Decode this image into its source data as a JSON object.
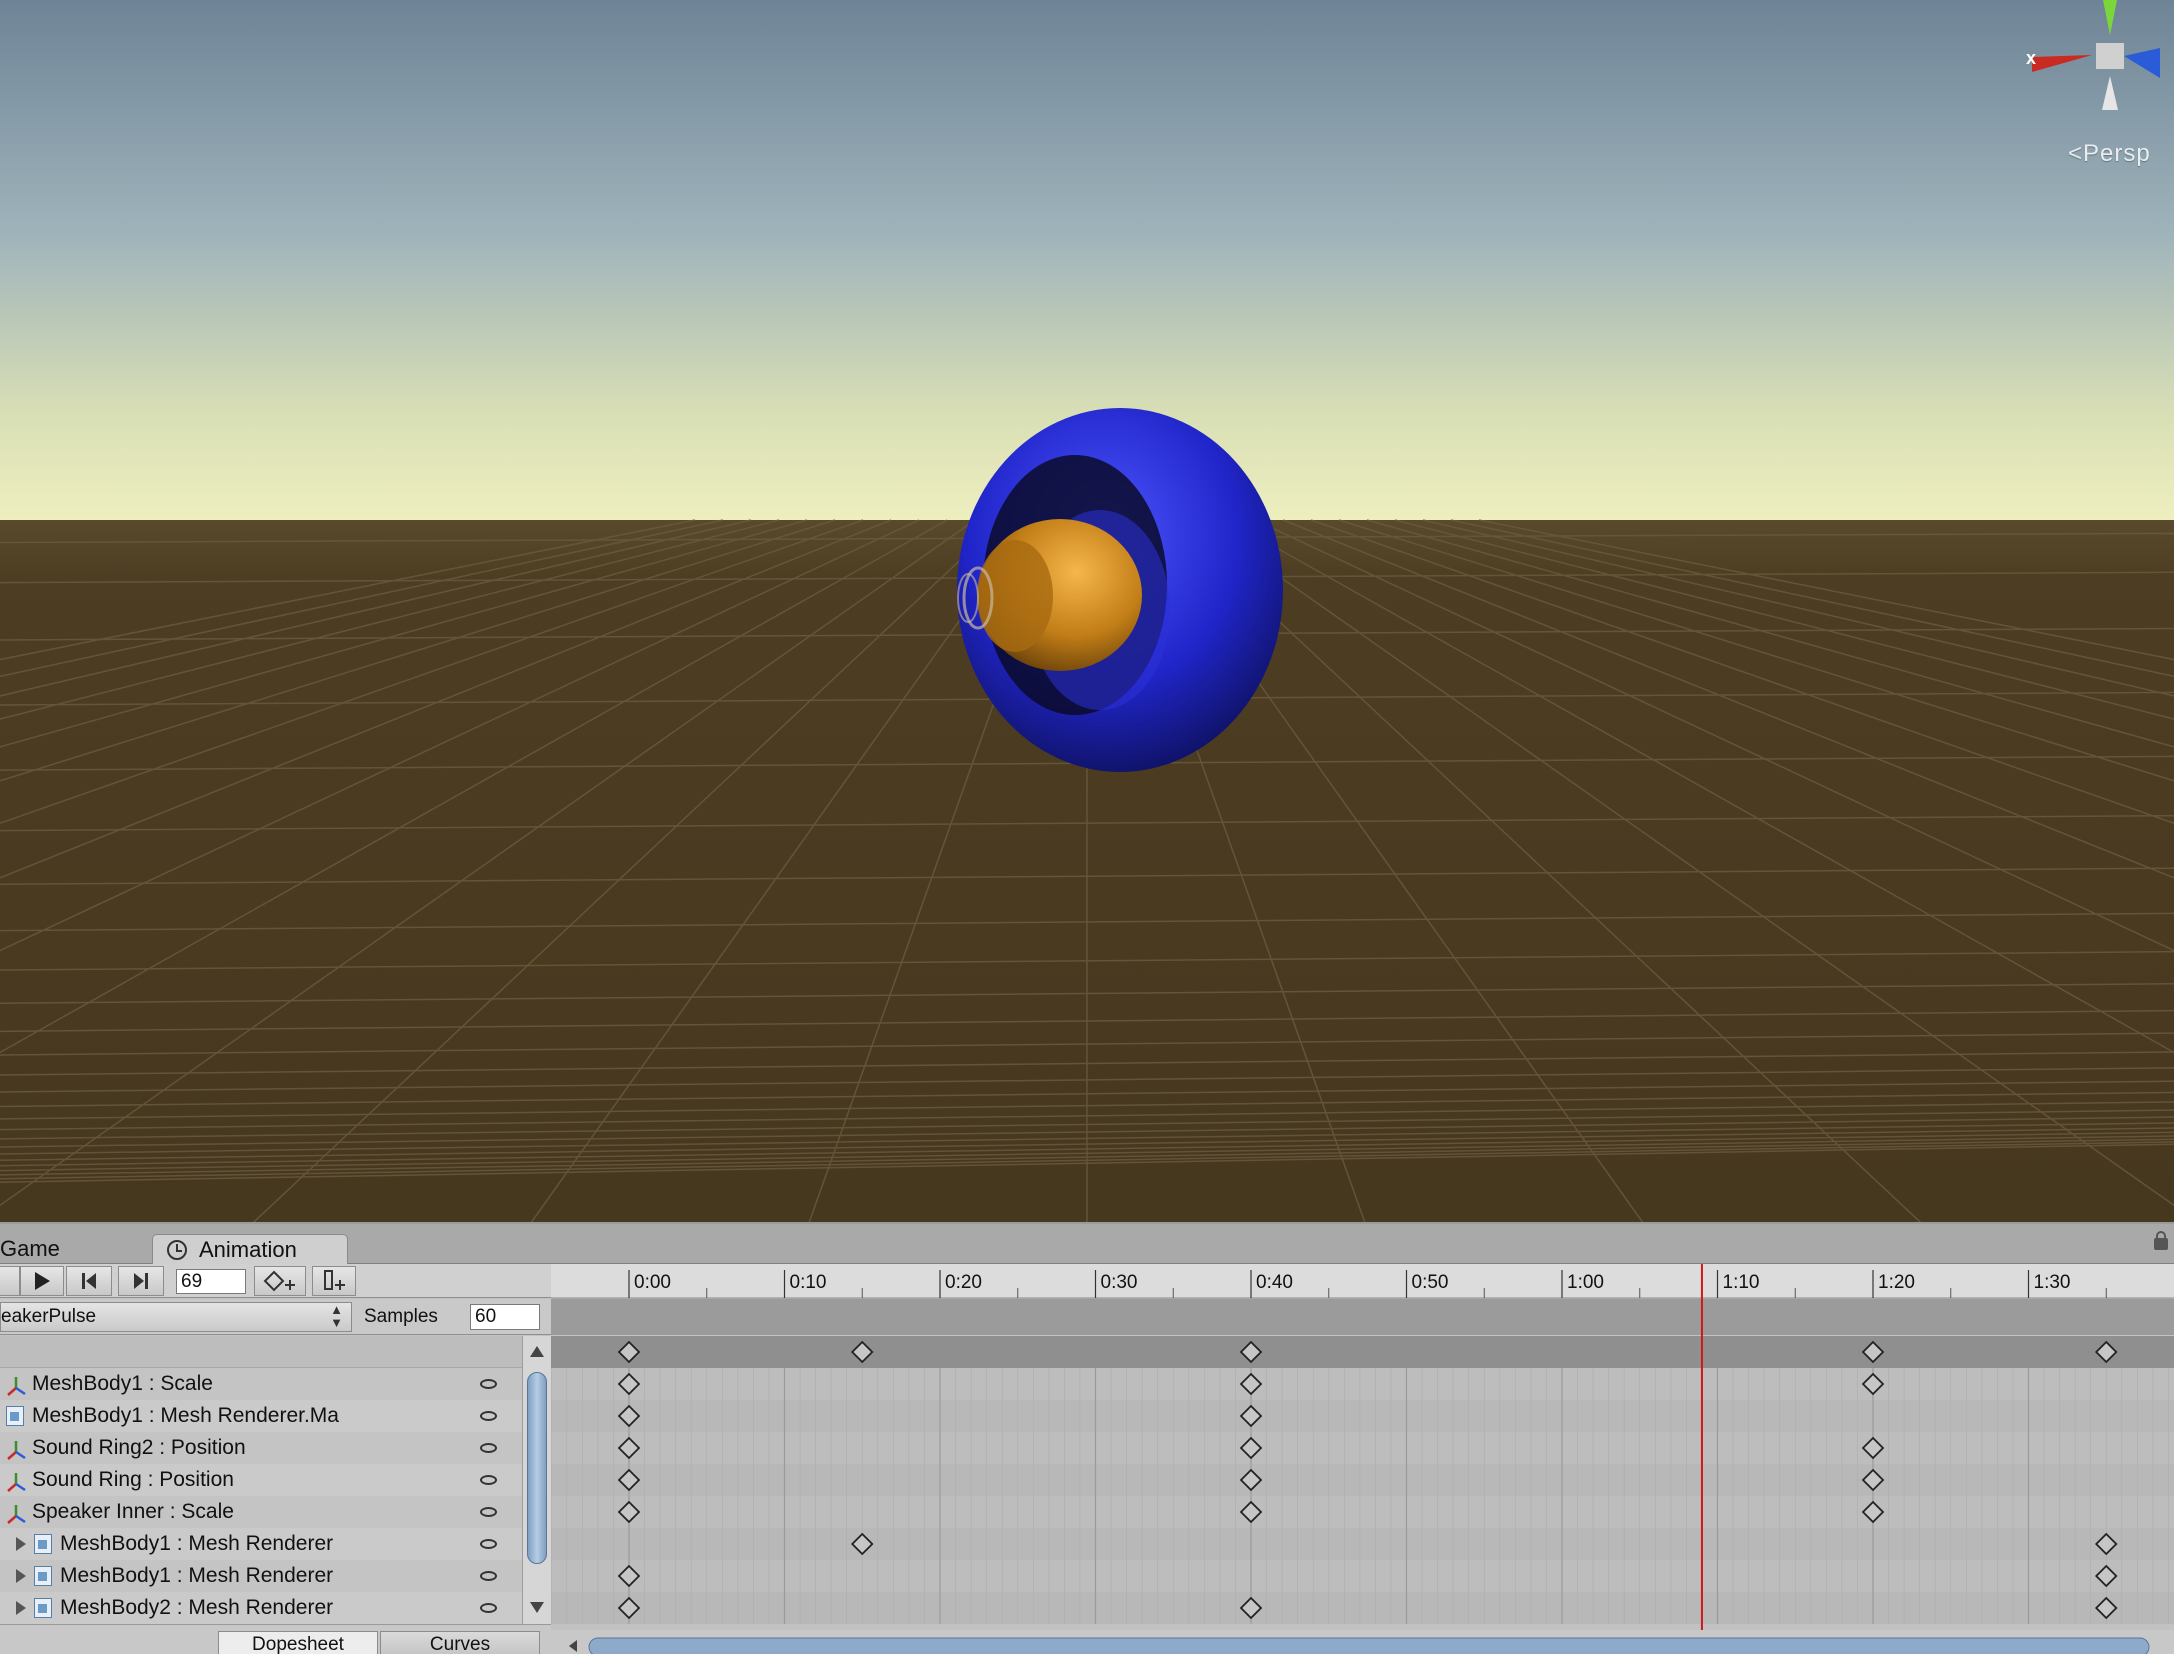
{
  "scene": {
    "camera_label": "Persp",
    "gizmo_axis_label": "x"
  },
  "tabs": {
    "game": "Game",
    "animation": "Animation"
  },
  "toolbar": {
    "frame": "69"
  },
  "clip": {
    "name": "eakerPulse",
    "samples_label": "Samples",
    "samples_value": "60"
  },
  "ruler": {
    "labels": [
      "0:00",
      "0:10",
      "0:20",
      "0:30",
      "0:40",
      "0:50",
      "1:00",
      "1:10",
      "1:20",
      "1:30"
    ]
  },
  "properties": [
    {
      "label": "MeshBody1 : Scale",
      "icon": "axes-icon",
      "expand": false
    },
    {
      "label": "MeshBody1 : Mesh Renderer.Ma",
      "icon": "mesh-renderer-icon",
      "expand": false
    },
    {
      "label": "Sound Ring2 : Position",
      "icon": "axes-icon",
      "expand": false
    },
    {
      "label": "Sound Ring : Position",
      "icon": "axes-icon",
      "expand": false
    },
    {
      "label": "Speaker Inner : Scale",
      "icon": "axes-icon",
      "expand": false
    },
    {
      "label": "MeshBody1 : Mesh Renderer",
      "icon": "mesh-renderer-icon",
      "expand": true
    },
    {
      "label": "MeshBody1 : Mesh Renderer",
      "icon": "mesh-renderer-icon",
      "expand": true
    },
    {
      "label": "MeshBody2 : Mesh Renderer",
      "icon": "mesh-renderer-icon",
      "expand": true
    }
  ],
  "keyframes": {
    "summary": [
      0,
      15,
      40,
      80,
      95
    ],
    "rows": [
      [
        0,
        40,
        80
      ],
      [
        0,
        40
      ],
      [
        0,
        40,
        80
      ],
      [
        0,
        40,
        80
      ],
      [
        0,
        40,
        80
      ],
      [
        15,
        95
      ],
      [
        0,
        95
      ],
      [
        0,
        40,
        95
      ]
    ]
  },
  "playhead_frame": 69,
  "bottom_tabs": {
    "dopesheet": "Dopesheet",
    "curves": "Curves"
  },
  "colors": {
    "playhead": "#d01818",
    "torus": "#2a2fd8",
    "cone": "#d08a1c",
    "ground": "#4a3a21"
  }
}
